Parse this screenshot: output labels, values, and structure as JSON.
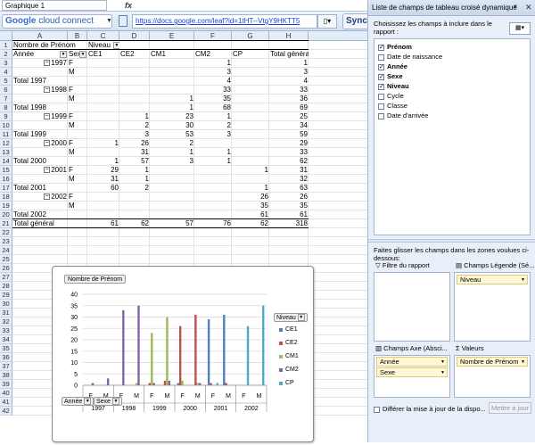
{
  "formula_bar": {
    "name_box": "Graphique 1",
    "fx": "fx"
  },
  "toolbar": {
    "gcc_google": "Google",
    "gcc_rest": " cloud connect",
    "url": "https://docs.google.com/leaf?id=1tHT--VtgY9HKTT5",
    "sync_label": "Sync"
  },
  "columns": [
    "A",
    "B",
    "C",
    "D",
    "E",
    "F",
    "G",
    "H"
  ],
  "rows": [
    {
      "n": "1",
      "a": "Nombre de Prénom",
      "b": "",
      "c": "Niveau",
      "d": "",
      "e": "",
      "f": "",
      "g": "",
      "h": ""
    },
    {
      "n": "2",
      "a": "Année",
      "b": "Sexe",
      "c": "CE1",
      "d": "CE2",
      "e": "CM1",
      "f": "CM2",
      "g": "CP",
      "h": "Total général"
    },
    {
      "n": "3",
      "a": "1997",
      "b": "F",
      "c": "",
      "d": "",
      "e": "",
      "f": "1",
      "g": "",
      "h": "1"
    },
    {
      "n": "4",
      "a": "",
      "b": "M",
      "c": "",
      "d": "",
      "e": "",
      "f": "3",
      "g": "",
      "h": "3"
    },
    {
      "n": "5",
      "a": "Total 1997",
      "b": "",
      "c": "",
      "d": "",
      "e": "",
      "f": "4",
      "g": "",
      "h": "4"
    },
    {
      "n": "6",
      "a": "1998",
      "b": "F",
      "c": "",
      "d": "",
      "e": "",
      "f": "33",
      "g": "",
      "h": "33"
    },
    {
      "n": "7",
      "a": "",
      "b": "M",
      "c": "",
      "d": "",
      "e": "1",
      "f": "35",
      "g": "",
      "h": "36"
    },
    {
      "n": "8",
      "a": "Total 1998",
      "b": "",
      "c": "",
      "d": "",
      "e": "1",
      "f": "68",
      "g": "",
      "h": "69"
    },
    {
      "n": "9",
      "a": "1999",
      "b": "F",
      "c": "",
      "d": "1",
      "e": "23",
      "f": "1",
      "g": "",
      "h": "25"
    },
    {
      "n": "10",
      "a": "",
      "b": "M",
      "c": "",
      "d": "2",
      "e": "30",
      "f": "2",
      "g": "",
      "h": "34"
    },
    {
      "n": "11",
      "a": "Total 1999",
      "b": "",
      "c": "",
      "d": "3",
      "e": "53",
      "f": "3",
      "g": "",
      "h": "59"
    },
    {
      "n": "12",
      "a": "2000",
      "b": "F",
      "c": "1",
      "d": "26",
      "e": "2",
      "f": "",
      "g": "",
      "h": "29"
    },
    {
      "n": "13",
      "a": "",
      "b": "M",
      "c": "",
      "d": "31",
      "e": "1",
      "f": "1",
      "g": "",
      "h": "33"
    },
    {
      "n": "14",
      "a": "Total 2000",
      "b": "",
      "c": "1",
      "d": "57",
      "e": "3",
      "f": "1",
      "g": "",
      "h": "62"
    },
    {
      "n": "15",
      "a": "2001",
      "b": "F",
      "c": "29",
      "d": "1",
      "e": "",
      "f": "",
      "g": "1",
      "h": "31"
    },
    {
      "n": "16",
      "a": "",
      "b": "M",
      "c": "31",
      "d": "1",
      "e": "",
      "f": "",
      "g": "",
      "h": "32"
    },
    {
      "n": "17",
      "a": "Total 2001",
      "b": "",
      "c": "60",
      "d": "2",
      "e": "",
      "f": "",
      "g": "1",
      "h": "63"
    },
    {
      "n": "18",
      "a": "2002",
      "b": "F",
      "c": "",
      "d": "",
      "e": "",
      "f": "",
      "g": "26",
      "h": "26"
    },
    {
      "n": "19",
      "a": "",
      "b": "M",
      "c": "",
      "d": "",
      "e": "",
      "f": "",
      "g": "35",
      "h": "35"
    },
    {
      "n": "20",
      "a": "Total 2002",
      "b": "",
      "c": "",
      "d": "",
      "e": "",
      "f": "",
      "g": "61",
      "h": "61"
    },
    {
      "n": "21",
      "a": "Total général",
      "b": "",
      "c": "61",
      "d": "62",
      "e": "57",
      "f": "76",
      "g": "62",
      "h": "318"
    }
  ],
  "extra_rows": [
    "22",
    "23",
    "24",
    "25",
    "26",
    "27",
    "28",
    "29",
    "30",
    "31",
    "32",
    "33",
    "34",
    "35",
    "36",
    "37",
    "38",
    "39",
    "40",
    "41",
    "42"
  ],
  "chart_data": {
    "type": "bar",
    "title_button": "Nombre de Prénom",
    "legend_button": "Niveau",
    "axis_buttons": [
      "Année",
      "Sexe"
    ],
    "years": [
      "1997",
      "1998",
      "1999",
      "2000",
      "2001",
      "2002"
    ],
    "sexes": [
      "F",
      "M"
    ],
    "categories": [
      "1997 F",
      "1997 M",
      "1998 F",
      "1998 M",
      "1999 F",
      "1999 M",
      "2000 F",
      "2000 M",
      "2001 F",
      "2001 M",
      "2002 F",
      "2002 M"
    ],
    "series": [
      {
        "name": "CE1",
        "color": "#4f81bd",
        "values": [
          0,
          0,
          0,
          0,
          0,
          0,
          1,
          0,
          29,
          31,
          0,
          0
        ]
      },
      {
        "name": "CE2",
        "color": "#c0504d",
        "values": [
          0,
          0,
          0,
          0,
          1,
          2,
          26,
          31,
          1,
          1,
          0,
          0
        ]
      },
      {
        "name": "CM1",
        "color": "#9bbb59",
        "values": [
          0,
          0,
          0,
          1,
          23,
          30,
          2,
          1,
          0,
          0,
          0,
          0
        ]
      },
      {
        "name": "CM2",
        "color": "#8064a2",
        "values": [
          1,
          3,
          33,
          35,
          1,
          2,
          0,
          1,
          0,
          0,
          0,
          0
        ]
      },
      {
        "name": "CP",
        "color": "#4bacc6",
        "values": [
          0,
          0,
          0,
          0,
          0,
          0,
          0,
          0,
          1,
          0,
          26,
          35
        ]
      }
    ],
    "ylim": [
      0,
      40
    ],
    "yticks": [
      "0",
      "5",
      "10",
      "15",
      "20",
      "25",
      "30",
      "35",
      "40"
    ],
    "grid": true,
    "legend_position": "right"
  },
  "pane": {
    "title": "Liste de champs de tableau croisé dynamique",
    "instruction": "Choisissez les champs à inclure dans le rapport :",
    "fields": [
      {
        "label": "Prénom",
        "checked": true
      },
      {
        "label": "Date de naissance",
        "checked": false
      },
      {
        "label": "Année",
        "checked": true
      },
      {
        "label": "Sexe",
        "checked": true
      },
      {
        "label": "Niveau",
        "checked": true
      },
      {
        "label": "Cycle",
        "checked": false
      },
      {
        "label": "Classe",
        "checked": false
      },
      {
        "label": "Date d'arrivée",
        "checked": false
      }
    ],
    "drag_text": "Faites glisser les champs dans les zones voulues ci-dessous:",
    "area_filter": "Filtre du rapport",
    "area_legend": "Champs Légende (Sé...",
    "area_axis": "Champs Axe (Absci...",
    "area_values": "Valeurs",
    "legend_chip": "Niveau",
    "axis_chips": [
      "Année",
      "Sexe"
    ],
    "values_chip": "Nombre de Prénom",
    "defer_label": "Différer la mise à jour de la dispo...",
    "update_label": "Mettre à jour"
  }
}
